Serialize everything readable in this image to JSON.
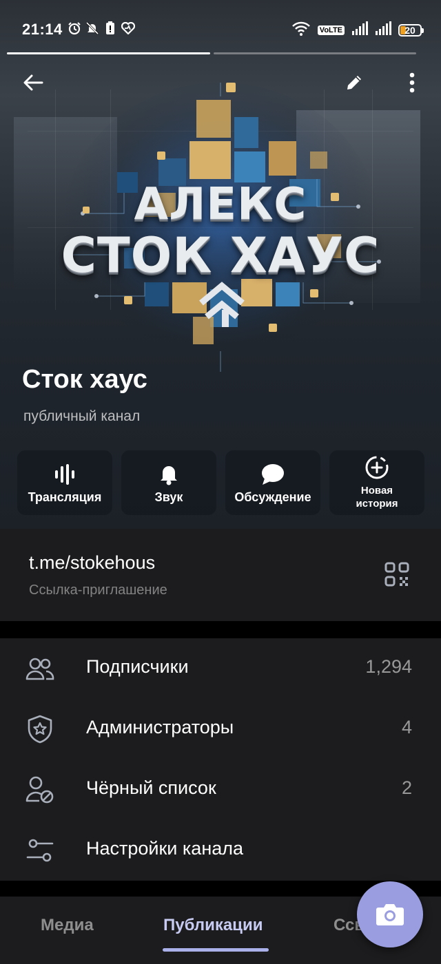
{
  "status_bar": {
    "time": "21:14",
    "volte_label": "VoLTE",
    "battery_level": "20",
    "left_icons": [
      "alarm-icon",
      "bell-off-icon",
      "battery-alert-icon",
      "heart-icon"
    ],
    "right_icons": [
      "wifi-icon",
      "volte-icon",
      "signal-icon",
      "signal-icon",
      "battery-icon"
    ]
  },
  "story": {
    "segments": 2,
    "active_segment": 1
  },
  "header": {
    "logo_line1": "АЛЕКС",
    "logo_line2": "СТОК ХАУС",
    "channel_name": "Сток хаус",
    "channel_type": "публичный канал"
  },
  "actions": [
    {
      "label": "Трансляция",
      "icon": "live-stream-icon"
    },
    {
      "label": "Звук",
      "icon": "bell-icon"
    },
    {
      "label": "Обсуждение",
      "icon": "chat-bubble-icon"
    },
    {
      "label": "Новая\nистория",
      "icon": "add-story-icon"
    }
  ],
  "invite": {
    "url": "t.me/stokehous",
    "subtitle": "Ссылка-приглашение"
  },
  "menu": [
    {
      "label": "Подписчики",
      "value": "1,294",
      "icon": "users-icon"
    },
    {
      "label": "Администраторы",
      "value": "4",
      "icon": "shield-star-icon"
    },
    {
      "label": "Чёрный список",
      "value": "2",
      "icon": "user-blocked-icon"
    },
    {
      "label": "Настройки канала",
      "value": "",
      "icon": "settings-sliders-icon"
    }
  ],
  "tabs": [
    {
      "label": "Медиа",
      "active": false
    },
    {
      "label": "Публикации",
      "active": true
    },
    {
      "label": "Ссылки",
      "active": false
    }
  ],
  "colors": {
    "accent": "#9a9ee0",
    "panel": "#1c1c1e",
    "battery": "#f0a020"
  }
}
